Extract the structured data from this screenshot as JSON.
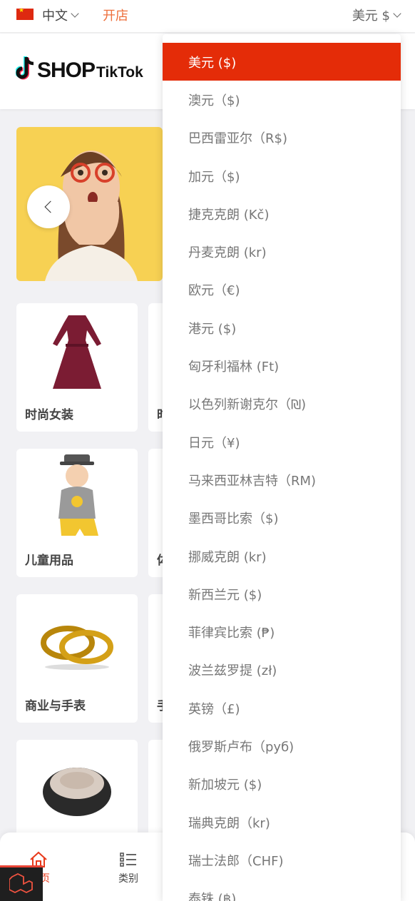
{
  "topbar": {
    "language_label": "中文",
    "open_shop_label": "开店",
    "currency_label": "美元 $"
  },
  "header": {
    "logo_text_main": "SHOP",
    "logo_text_sub": "TikTok"
  },
  "categories": [
    {
      "label": "时尚女装",
      "peek_label": "时"
    },
    {
      "label": "儿童用品",
      "peek_label": "体"
    },
    {
      "label": "商业与手表",
      "peek_label": "手"
    },
    {
      "label": "",
      "peek_label": ""
    }
  ],
  "bottom_nav": {
    "home_label": "页",
    "category_label": "类别"
  },
  "currency_menu": {
    "items": [
      "美元 ($)",
      "澳元（$)",
      "巴西雷亚尔（R$)",
      "加元（$)",
      "捷克克朗 (Kč)",
      "丹麦克朗 (kr)",
      "欧元（€)",
      "港元 ($)",
      "匈牙利福林 (Ft)",
      "以色列新谢克尔（₪)",
      "日元（¥)",
      "马来西亚林吉特（RM)",
      "墨西哥比索（$)",
      "挪威克朗 (kr)",
      "新西兰元 ($)",
      "菲律宾比索 (₱)",
      "波兰兹罗提 (zł)",
      "英镑（£)",
      "俄罗斯卢布（руб)",
      "新加坡元 ($)",
      "瑞典克朗（kr)",
      "瑞士法郎（CHF)",
      "泰铢 (฿)"
    ],
    "active_index": 0
  },
  "colors": {
    "accent": "#e42c08",
    "open_shop": "#ee6f3b",
    "banner_bg": "#f7d153"
  }
}
